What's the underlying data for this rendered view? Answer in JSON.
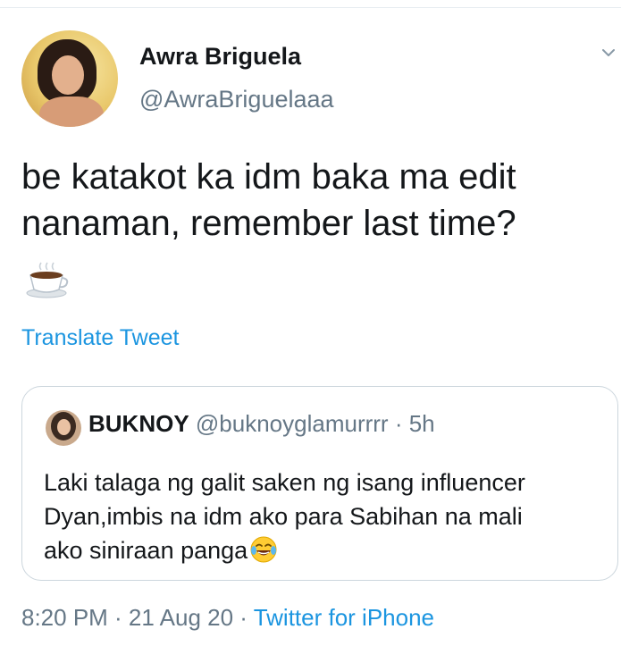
{
  "author": {
    "display_name": "Awra Briguela",
    "handle": "@AwraBriguelaaa"
  },
  "tweet": {
    "text_lines": [
      "be katakot ka idm baka ma edit",
      "nanaman, remember last time?"
    ],
    "emoji": "coffee-emoji",
    "translate_label": "Translate Tweet"
  },
  "quoted": {
    "display_name": "BUKNOY",
    "handle": "@buknoyglamurrrr",
    "separator": " · ",
    "age": "5h",
    "text_lines": [
      "Laki talaga ng galit saken ng isang influencer",
      "Dyan,imbis na idm ako para Sabihan na mali",
      "ako siniraan panga"
    ],
    "emoji": "face-with-tears-of-joy-emoji"
  },
  "meta": {
    "timestamp": "8:20 PM · 21 Aug 20 · ",
    "source": "Twitter for iPhone"
  },
  "icons": {
    "more_menu": "chevron-down-icon"
  },
  "colors": {
    "link": "#1b95e0",
    "secondary_text": "#657786",
    "primary_text": "#14171a",
    "border": "#ccd6dd"
  }
}
